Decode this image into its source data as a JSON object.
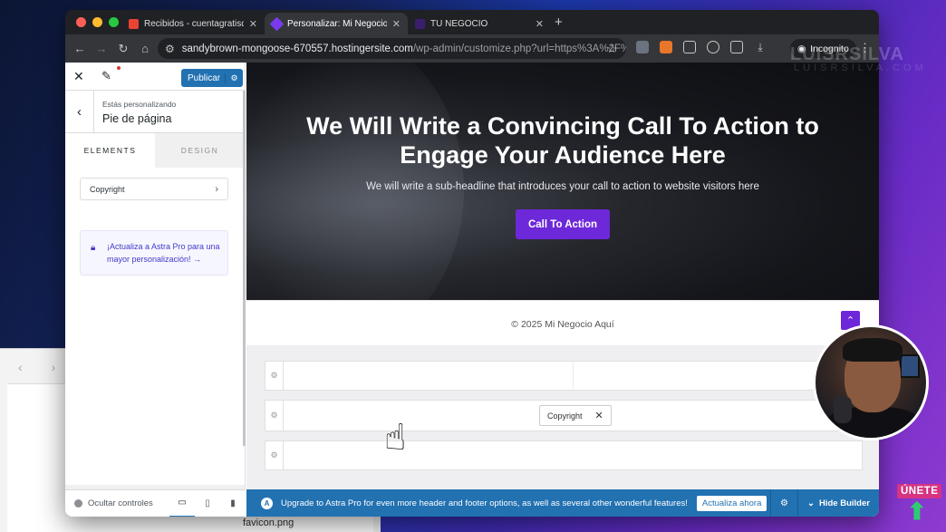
{
  "browser": {
    "tabs": [
      {
        "label": "Recibidos - cuentagratisdeln",
        "icon_color": "#ea4335",
        "active": false
      },
      {
        "label": "Personalizar: Mi Negocio Aquí",
        "icon_color": "#7c3aed",
        "active": true
      },
      {
        "label": "TU NEGOCIO",
        "icon_color": "#6d28d9",
        "active": false
      }
    ],
    "close_glyph": "✕",
    "new_tab_glyph": "+",
    "url_main": "sandybrown-mongoose-670557.hostingersite.com",
    "url_rest": "/wp-admin/customize.php?url=https%3A%2F%2Fsa...",
    "incognito_label": "Incognito"
  },
  "customizer": {
    "publish_label": "Publicar",
    "customizing_label": "Estás personalizando",
    "section_title": "Pie de página",
    "tab_elements": "ELEMENTS",
    "tab_design": "DESIGN",
    "copyright_item": "Copyright",
    "pro_notice": "¡Actualiza a Astra Pro para una mayor personalización! →",
    "hide_controls_label": "Ocultar controles"
  },
  "preview": {
    "hero_title": "We Will Write a Convincing Call To Action to Engage Your Audience Here",
    "hero_subtitle": "We will write a sub-headline that introduces your call to action to website visitors here",
    "cta_label": "Call To Action",
    "footer_copyright": "© 2025 Mi Negocio Aquí",
    "builder_chip_label": "Copyright"
  },
  "upgrade_bar": {
    "message": "Upgrade to Astra Pro for even more header and footer options, as well as several other wonderful features!",
    "button_label": "Actualiza ahora",
    "hide_builder_label": "Hide Builder"
  },
  "background": {
    "finder_filename": "favicon.png"
  },
  "overlay": {
    "watermark": "LUISRSILVA",
    "watermark_sub": "LUISRSILVA.COM",
    "join_label": "ÚNETE"
  },
  "colors": {
    "wp_blue": "#2271b1",
    "astra_purple": "#6d28d9"
  }
}
